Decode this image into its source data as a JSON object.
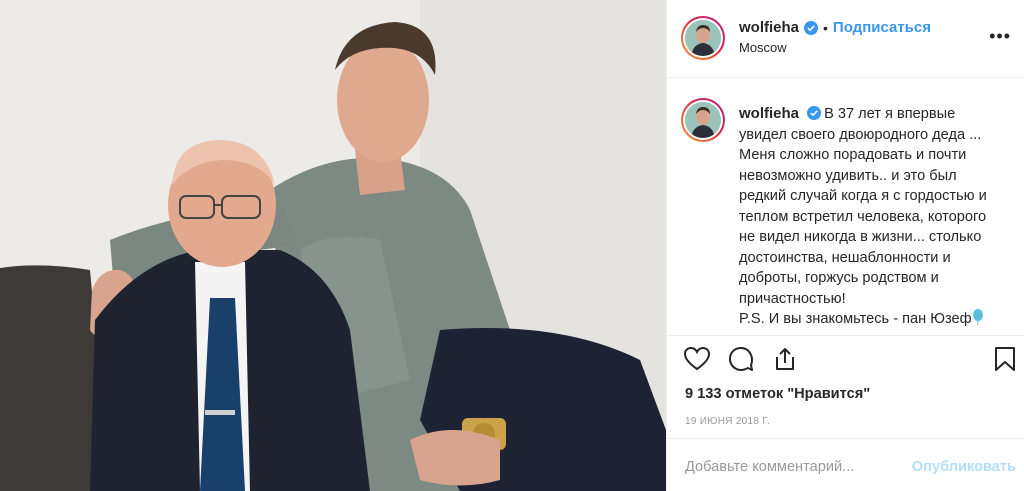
{
  "post": {
    "photo_alt": "Photo of two men seated against a light wall",
    "colors": {
      "accent": "#3897f0",
      "verified": "#3897f0",
      "text": "#262626",
      "muted": "#999999",
      "publish_disabled": "#b2dffc"
    }
  },
  "header": {
    "username": "wolfieha",
    "separator": "•",
    "follow_label": "Подписаться",
    "location": "Moscow",
    "more_label": "•••",
    "verified_icon": "verified-badge-icon"
  },
  "caption": {
    "username": "wolfieha",
    "lines": [
      "В 37 лет я впервые",
      "увидел своего двоюродного деда ...",
      "Меня сложно порадовать и почти",
      "невозможно удивить.. и это был",
      "редкий случай когда я с гордостью и",
      "теплом встретил человека, которого",
      "не видел никогда в жизни... столько",
      "достоинства, нешаблонности и",
      "доброты, горжусь родством и",
      "причастностью!",
      "P.S. И вы знакомьтесь - пан Юзеф"
    ],
    "emoji": "balloon-icon"
  },
  "actions": {
    "like_icon": "heart-icon",
    "comment_icon": "comment-icon",
    "share_icon": "share-icon",
    "save_icon": "bookmark-icon"
  },
  "likes_text": "9 133 отметок \"Нравится\"",
  "date_text": "19 июня 2018 г.",
  "comment": {
    "placeholder": "Добавьте комментарий...",
    "publish_label": "Опубликовать"
  }
}
